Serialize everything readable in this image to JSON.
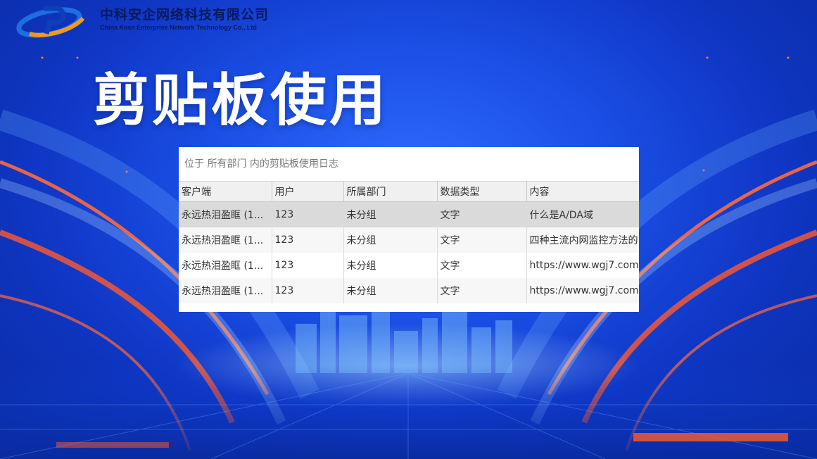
{
  "company": {
    "name_cn": "中科安企网络科技有限公司",
    "name_en": "China Kean Enterprise Network Technology Co., Ltd"
  },
  "slide": {
    "title": "剪贴板使用"
  },
  "log_panel": {
    "caption": "位于 所有部门 内的剪贴板使用日志",
    "columns": [
      "客户端",
      "用户",
      "所属部门",
      "数据类型",
      "内容"
    ],
    "rows": [
      {
        "client": "永远热泪盈眶 (1...",
        "user": "123",
        "department": "未分组",
        "data_type": "文字",
        "content": "什么是A/DA域"
      },
      {
        "client": "永远热泪盈眶 (1...",
        "user": "123",
        "department": "未分组",
        "data_type": "文字",
        "content": "四种主流内网监控方法的"
      },
      {
        "client": "永远热泪盈眶 (1...",
        "user": "123",
        "department": "未分组",
        "data_type": "文字",
        "content": "https://www.wgj7.com"
      },
      {
        "client": "永远热泪盈眶 (1...",
        "user": "123",
        "department": "未分组",
        "data_type": "文字",
        "content": "https://www.wgj7.com"
      }
    ]
  },
  "colors": {
    "background_center": "#2f6bff",
    "background_edge": "#0a2a9e",
    "accent_orange": "#ff5a2a",
    "logo_orange": "#f29a1c",
    "logo_blue": "#1d6fe0"
  }
}
